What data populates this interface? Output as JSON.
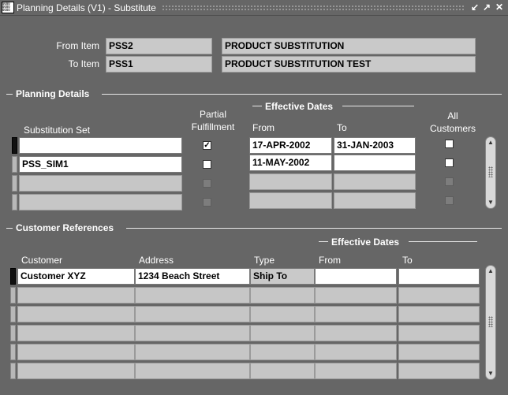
{
  "window": {
    "title": "Planning Details (V1) - Substitute",
    "icon_text": "0000 0000 0000",
    "buttons": {
      "minimize": "↙",
      "maximize": "↗",
      "close": "✕"
    }
  },
  "items": {
    "from_label": "From Item",
    "from_code": "PSS2",
    "from_desc": "PRODUCT SUBSTITUTION",
    "to_label": "To Item",
    "to_code": "PSS1",
    "to_desc": "PRODUCT SUBSTITUTION TEST"
  },
  "planning": {
    "section_title": "Planning Details",
    "col_subset": "Substitution Set",
    "col_partial_1": "Partial",
    "col_partial_2": "Fulfillment",
    "eff_dates": "Effective Dates",
    "col_from": "From",
    "col_to": "To",
    "col_all_1": "All",
    "col_all_2": "Customers",
    "rows": [
      {
        "subset": "",
        "partial": "✓",
        "from": "17-APR-2002",
        "to": "31-JAN-2003",
        "all": ""
      },
      {
        "subset": "PSS_SIM1",
        "partial": "",
        "from": "11-MAY-2002",
        "to": "",
        "all": ""
      },
      {
        "subset": "",
        "partial": "",
        "from": "",
        "to": "",
        "all": ""
      },
      {
        "subset": "",
        "partial": "",
        "from": "",
        "to": "",
        "all": ""
      }
    ]
  },
  "customers": {
    "section_title": "Customer References",
    "eff_dates": "Effective Dates",
    "col_customer": "Customer",
    "col_address": "Address",
    "col_type": "Type",
    "col_from": "From",
    "col_to": "To",
    "rows": [
      {
        "customer": "Customer XYZ",
        "address": "1234 Beach Street",
        "type": "Ship To",
        "from": "",
        "to": ""
      },
      {
        "customer": "",
        "address": "",
        "type": "",
        "from": "",
        "to": ""
      },
      {
        "customer": "",
        "address": "",
        "type": "",
        "from": "",
        "to": ""
      },
      {
        "customer": "",
        "address": "",
        "type": "",
        "from": "",
        "to": ""
      },
      {
        "customer": "",
        "address": "",
        "type": "",
        "from": "",
        "to": ""
      },
      {
        "customer": "",
        "address": "",
        "type": "",
        "from": "",
        "to": ""
      }
    ]
  }
}
